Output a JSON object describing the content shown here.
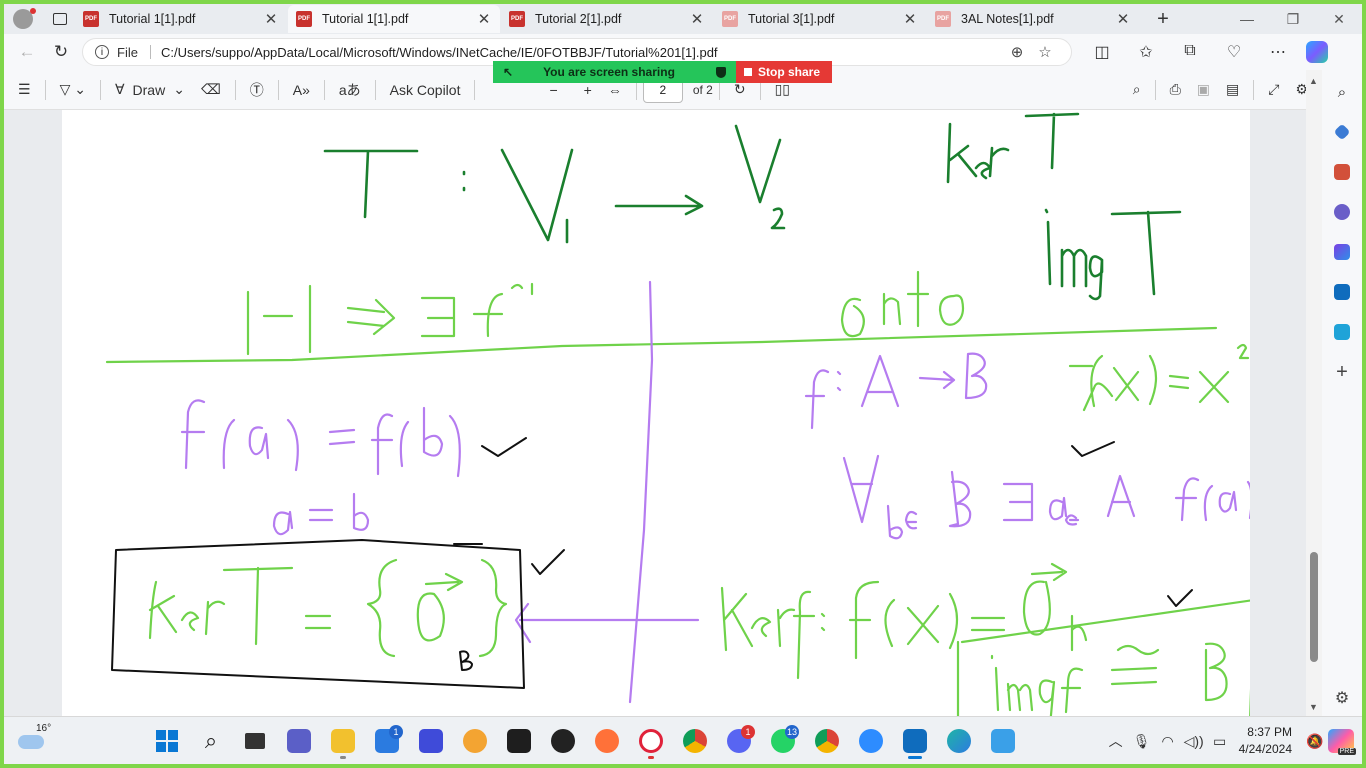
{
  "tabs": [
    {
      "title": "Tutorial 1[1].pdf",
      "active": false,
      "icon": "pdf-icon"
    },
    {
      "title": "Tutorial 1[1].pdf",
      "active": true,
      "icon": "pdf-icon"
    },
    {
      "title": "Tutorial 2[1].pdf",
      "active": false,
      "icon": "pdf-icon"
    },
    {
      "title": "Tutorial 3[1].pdf",
      "active": false,
      "icon": "pdf-icon"
    },
    {
      "title": "3AL Notes[1].pdf",
      "active": false,
      "icon": "pdf-icon"
    }
  ],
  "address": {
    "scheme_label": "File",
    "url": "C:/Users/suppo/AppData/Local/Microsoft/Windows/INetCache/IE/0FOTBBJF/Tutorial%201[1].pdf"
  },
  "sharing": {
    "status": "You are screen sharing",
    "stop_label": "Stop share"
  },
  "pdf_toolbar": {
    "draw_label": "Draw",
    "ask_copilot_label": "Ask Copilot",
    "current_page": "2",
    "page_count_label": "of 2"
  },
  "ink_colors": {
    "dark_green": "#1a7f2e",
    "light_green": "#6fd24a",
    "purple": "#b57cf0",
    "black": "#111111"
  },
  "taskbar": {
    "weather_temp": "16°",
    "badges": {
      "store": "1",
      "discord": "1",
      "whatsapp": "13"
    },
    "time": "8:37 PM",
    "date": "4/24/2024",
    "copilot_badge": "PRE"
  }
}
